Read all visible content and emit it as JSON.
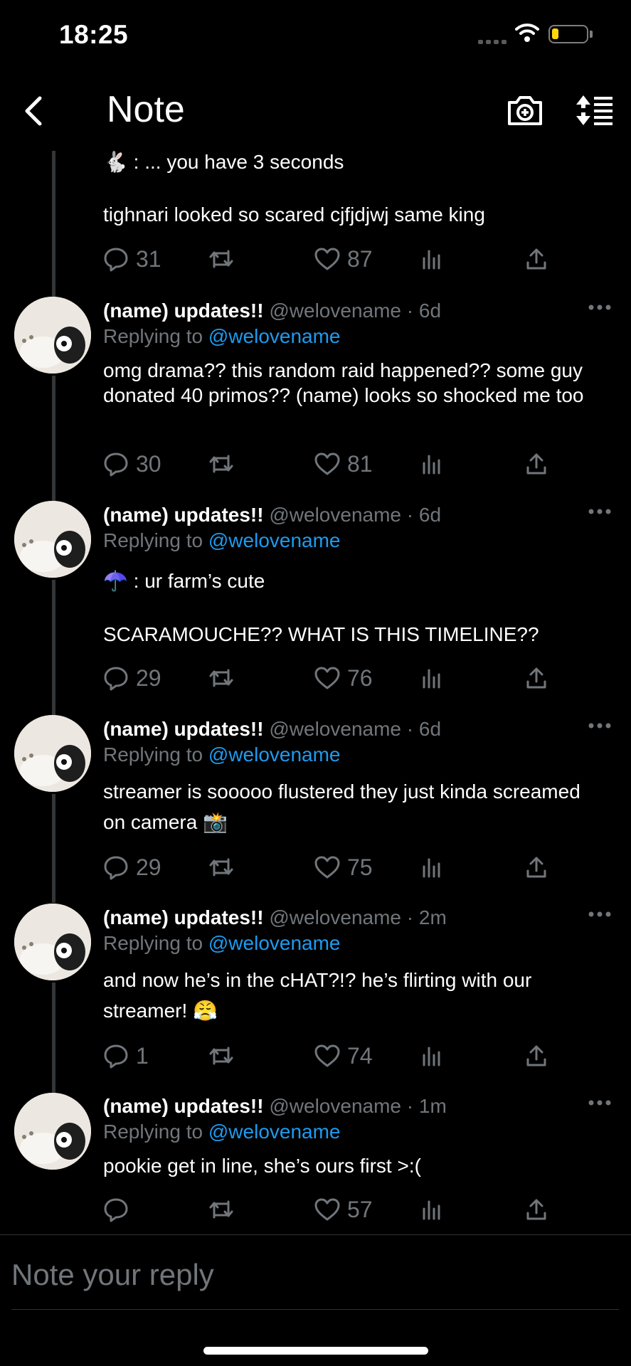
{
  "status_bar": {
    "time": "18:25"
  },
  "header": {
    "title": "Note"
  },
  "thread": {
    "top_tweet": {
      "line1_emoji": "🐇",
      "line1": " : ... you have 3 seconds",
      "line2": "tighnari looked so scared cjfjdjwj same king",
      "replies": "31",
      "likes": "87"
    },
    "tweets": [
      {
        "name": "(name) updates!!",
        "handle": "@welovename · 6d",
        "replying_prefix": "Replying to ",
        "replying_to": "@welovename",
        "text": "omg drama?? this random raid happened?? some guy donated 40 primos?? (name) looks so shocked me too",
        "replies": "30",
        "likes": "81"
      },
      {
        "name": "(name) updates!!",
        "handle": "@welovename · 6d",
        "replying_prefix": "Replying to ",
        "replying_to": "@welovename",
        "text_line1_emoji": "☂️",
        "text_line1": " : ur farm’s cute",
        "text_line2": "SCARAMOUCHE?? WHAT IS THIS TIMELINE??",
        "replies": "29",
        "likes": "76"
      },
      {
        "name": "(name) updates!!",
        "handle": "@welovename · 6d",
        "replying_prefix": "Replying to ",
        "replying_to": "@welovename",
        "text": "streamer is sooooo flustered they just kinda screamed on camera 📸",
        "replies": "29",
        "likes": "75"
      },
      {
        "name": "(name) updates!!",
        "handle": "@welovename · 2m",
        "replying_prefix": "Replying to ",
        "replying_to": "@welovename",
        "text": "and now he’s in the cHAT?!? he’s flirting with our streamer! 😤",
        "replies": "1",
        "likes": "74"
      },
      {
        "name": "(name) updates!!",
        "handle": "@welovename · 1m",
        "replying_prefix": "Replying to ",
        "replying_to": "@welovename",
        "text": "pookie get in line, she’s ours first >:(",
        "replies": "",
        "likes": "57"
      }
    ]
  },
  "reply_box": {
    "placeholder": "Note your reply"
  },
  "colors": {
    "background": "#000000",
    "text": "#e7e9ea",
    "muted": "#71767b",
    "accent": "#1d9bf0",
    "battery": "#ffd60a"
  }
}
